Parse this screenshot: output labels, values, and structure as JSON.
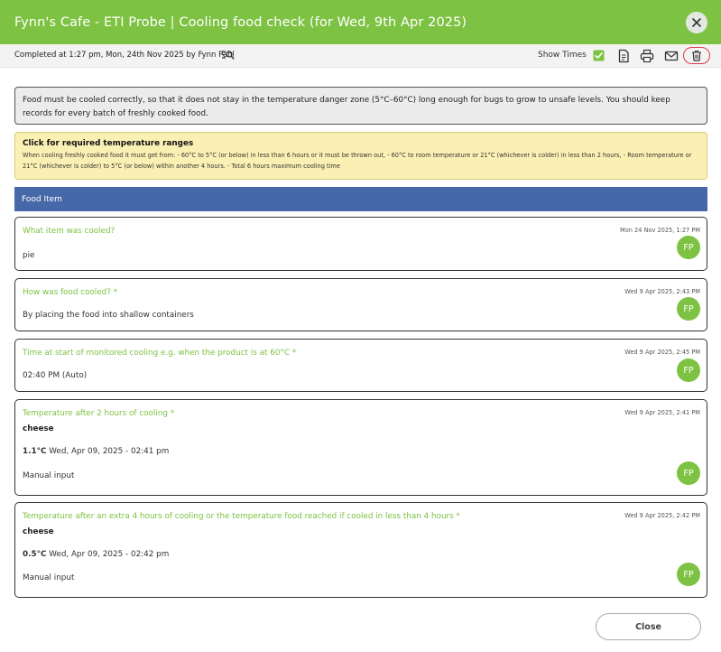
{
  "header": {
    "title": "Fynn's Cafe - ETI Probe | Cooling food check (for Wed, 9th Apr 2025)"
  },
  "toolbar": {
    "completed": "Completed at 1:27 pm, Mon, 24th Nov 2025  by Fynn Pahl",
    "show_times_label": "Show Times",
    "show_times_checked": true
  },
  "info": {
    "text": "Food must be cooled correctly, so that it does not stay in the temperature danger zone (5°C–60°C) long enough for bugs to grow to unsafe levels. You should keep records for every batch of freshly cooked food."
  },
  "ranges": {
    "title": "Click for required temperature ranges",
    "text": "When cooling freshly cooked food it must get from: - 60°C to 5°C (or below) in less than 6 hours or it must be thrown out, - 60°C to room temperature or 21°C (whichever is colder) in less than 2 hours, - Room temperature or 21°C (whichever is colder) to 5°C (or below) within another 4 hours. - Total 6 hours maximum cooling time"
  },
  "section": {
    "title": "Food Item"
  },
  "cards": [
    {
      "question": "What item was cooled?",
      "timestamp": "Mon 24 Nov 2025, 1:27 PM",
      "answer": "pie",
      "avatar": "FP"
    },
    {
      "question": "How was food cooled? *",
      "timestamp": "Wed 9 Apr 2025, 2:43 PM",
      "answer": "By placing the food into shallow containers",
      "avatar": "FP"
    },
    {
      "question": "Time at start of monitored cooling e.g. when the product is at 60°C *",
      "timestamp": "Wed 9 Apr 2025, 2:45 PM",
      "answer": "02:40 PM (Auto)",
      "avatar": "FP"
    },
    {
      "question": "Temperature after 2 hours of cooling *",
      "timestamp": "Wed 9 Apr 2025, 2:41 PM",
      "item": "cheese",
      "temp": "1.1°C",
      "temp_time": " Wed, Apr 09, 2025 - 02:41 pm",
      "method": "Manual input",
      "avatar": "FP"
    },
    {
      "question": "Temperature after an extra 4 hours of cooling or the temperature food reached if cooled in less than 4 hours *",
      "timestamp": "Wed 9 Apr 2025, 2:42 PM",
      "item": "cheese",
      "temp": "0.5°C",
      "temp_time": " Wed, Apr 09, 2025 - 02:42 pm",
      "method": "Manual input",
      "avatar": "FP"
    }
  ],
  "footer": {
    "close_label": "Close"
  },
  "colors": {
    "header_green": "#7dc242",
    "section_blue": "#4768a8",
    "delete_red": "#e0394b",
    "notice_yellow": "#fbf0b4"
  }
}
